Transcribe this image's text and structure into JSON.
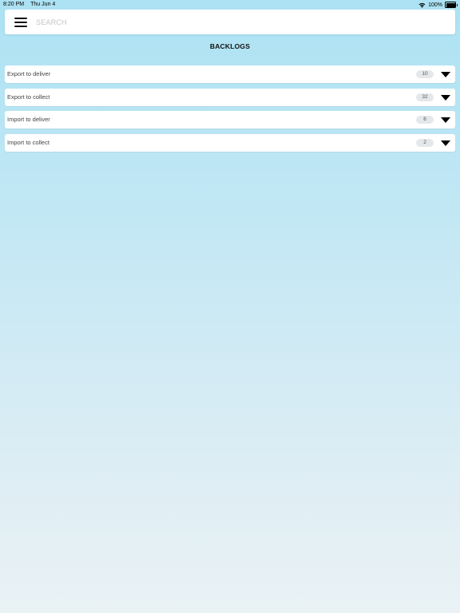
{
  "status_bar": {
    "time": "8:20 PM",
    "date": "Thu Jun 4",
    "battery": "100%",
    "wifi_icon": "wifi-icon",
    "battery_icon": "battery-icon"
  },
  "search": {
    "placeholder": "SEARCH",
    "value": "",
    "menu_icon": "hamburger-menu-icon"
  },
  "page": {
    "title": "BACKLOGS"
  },
  "backlogs": [
    {
      "label": "Export to deliver",
      "count": "10",
      "icon": "chevron-down-icon"
    },
    {
      "label": "Export to collect",
      "count": "32",
      "icon": "chevron-down-icon"
    },
    {
      "label": "Import to deliver",
      "count": "6",
      "icon": "chevron-down-icon"
    },
    {
      "label": "Import to collect",
      "count": "2",
      "icon": "chevron-down-icon"
    }
  ],
  "colors": {
    "background_top": "#ace2f3",
    "background_bottom": "#eaf2f5",
    "count_badge": "#e5e8ea"
  }
}
